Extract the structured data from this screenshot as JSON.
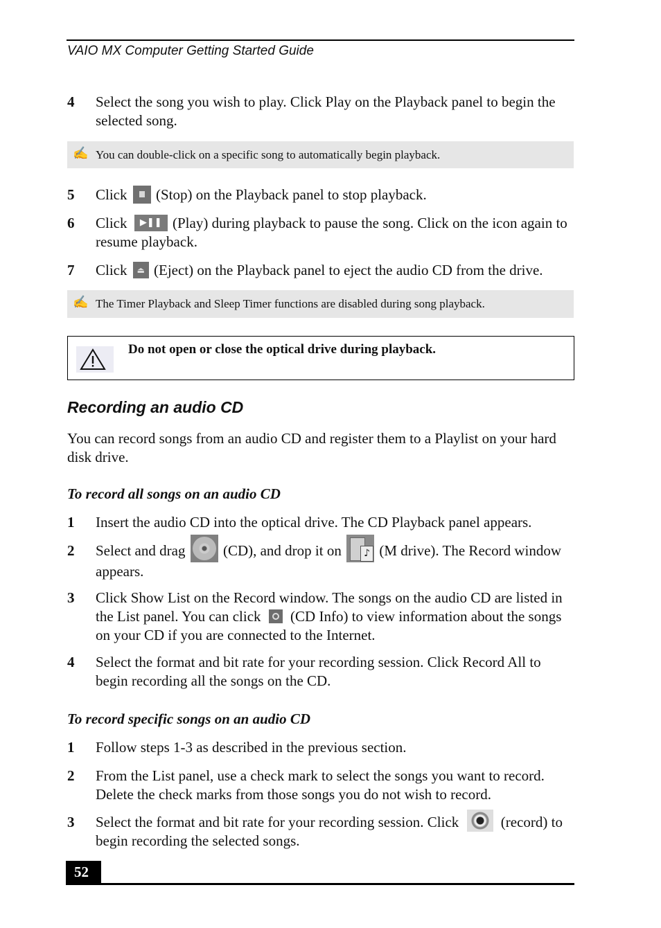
{
  "header": {
    "title": "VAIO MX Computer Getting Started Guide"
  },
  "steps_playback": [
    {
      "num": "4",
      "text": "Select the song you wish to play. Click Play on the Playback panel to begin the selected song."
    },
    {
      "num": "5",
      "pre": "Click",
      "icon": "stop-icon",
      "post": "(Stop) on the Playback panel to stop playback."
    },
    {
      "num": "6",
      "pre": "Click",
      "icon": "play-pause-icon",
      "icon_glyph": "▶❚❚",
      "post": "(Play) during playback to pause the song. Click on the icon again to resume playback."
    },
    {
      "num": "7",
      "pre": "Click",
      "icon": "eject-icon",
      "icon_glyph": "⏏",
      "post": "(Eject) on the Playback panel to eject the audio CD from the drive."
    }
  ],
  "notes": [
    {
      "icon": "note-pen-icon",
      "glyph": "✍",
      "text": "You can double-click on a specific song to automatically begin playback."
    },
    {
      "icon": "note-pen-icon",
      "glyph": "✍",
      "text": "The Timer Playback and Sleep Timer functions are disabled during song playback."
    }
  ],
  "warning": {
    "icon": "warning-icon",
    "text": "Do not open or close the optical drive during playback."
  },
  "section": {
    "title": "Recording an audio CD",
    "intro": "You can record songs from an audio CD and register them to a Playlist on your hard disk drive."
  },
  "record_all": {
    "heading": "To record all songs on an audio CD",
    "steps": [
      {
        "num": "1",
        "text": "Insert the audio CD into the optical drive. The CD Playback panel appears."
      },
      {
        "num": "2",
        "pre": "Select and drag",
        "mid": "(CD), and drop it on",
        "post": "(M drive). The Record window appears."
      },
      {
        "num": "3",
        "pre": "Click Show List on the Record window. The songs on the audio CD are listed in the List panel. You can click",
        "post": "(CD Info) to view information about the songs on your CD if you are connected to the Internet."
      },
      {
        "num": "4",
        "text": "Select the format and bit rate for your recording session. Click Record All to begin recording all the songs on the CD."
      }
    ]
  },
  "record_specific": {
    "heading": "To record specific songs on an audio CD",
    "steps": [
      {
        "num": "1",
        "text": "Follow steps 1-3 as described in the previous section."
      },
      {
        "num": "2",
        "text": "From the List panel, use a check mark to select the songs you want to record. Delete the check marks from those songs you do not wish to record."
      },
      {
        "num": "3",
        "pre": "Select the format and bit rate for your recording session. Click",
        "post": "(record) to begin recording the selected songs."
      }
    ]
  },
  "footer": {
    "page_number": "52"
  }
}
